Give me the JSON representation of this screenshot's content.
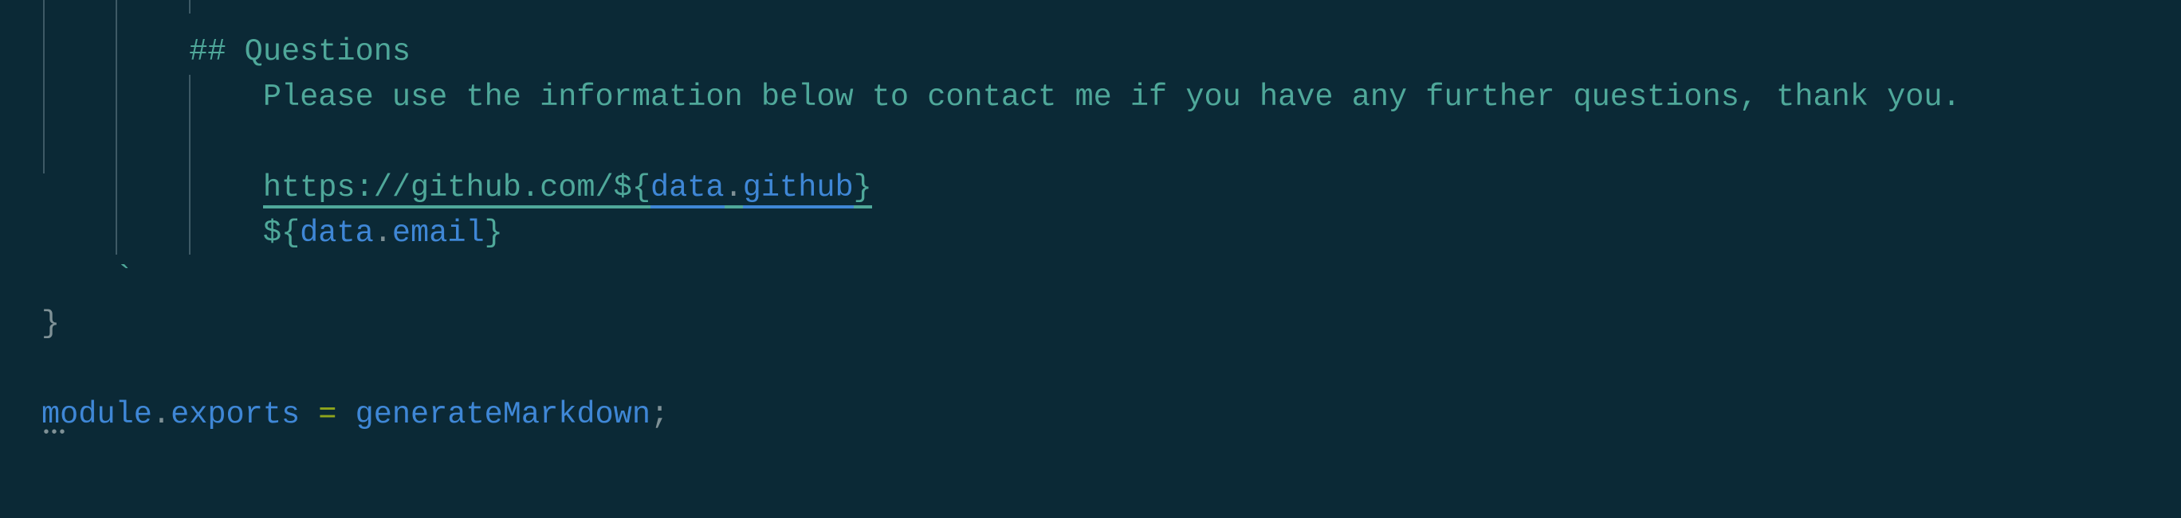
{
  "code": {
    "heading": "## Questions",
    "paragraph": "Please use the information below to contact me if you have any further questions, thank you.",
    "link_prefix": "https://github.com/${",
    "link_obj": "data",
    "link_dot": ".",
    "link_prop": "github",
    "link_close": "}",
    "email_open": "${",
    "email_obj": "data",
    "email_dot": ".",
    "email_prop": "email",
    "email_close": "}",
    "backtick": "`",
    "close_brace": "}",
    "export_obj": "module",
    "export_dot": ".",
    "export_prop": "exports",
    "export_eq": " = ",
    "export_value": "generateMarkdown",
    "export_semi": ";"
  },
  "colors": {
    "background": "#0b2936",
    "string": "#4fa89a",
    "identifier": "#3f87d6",
    "operator": "#8fa51c"
  }
}
